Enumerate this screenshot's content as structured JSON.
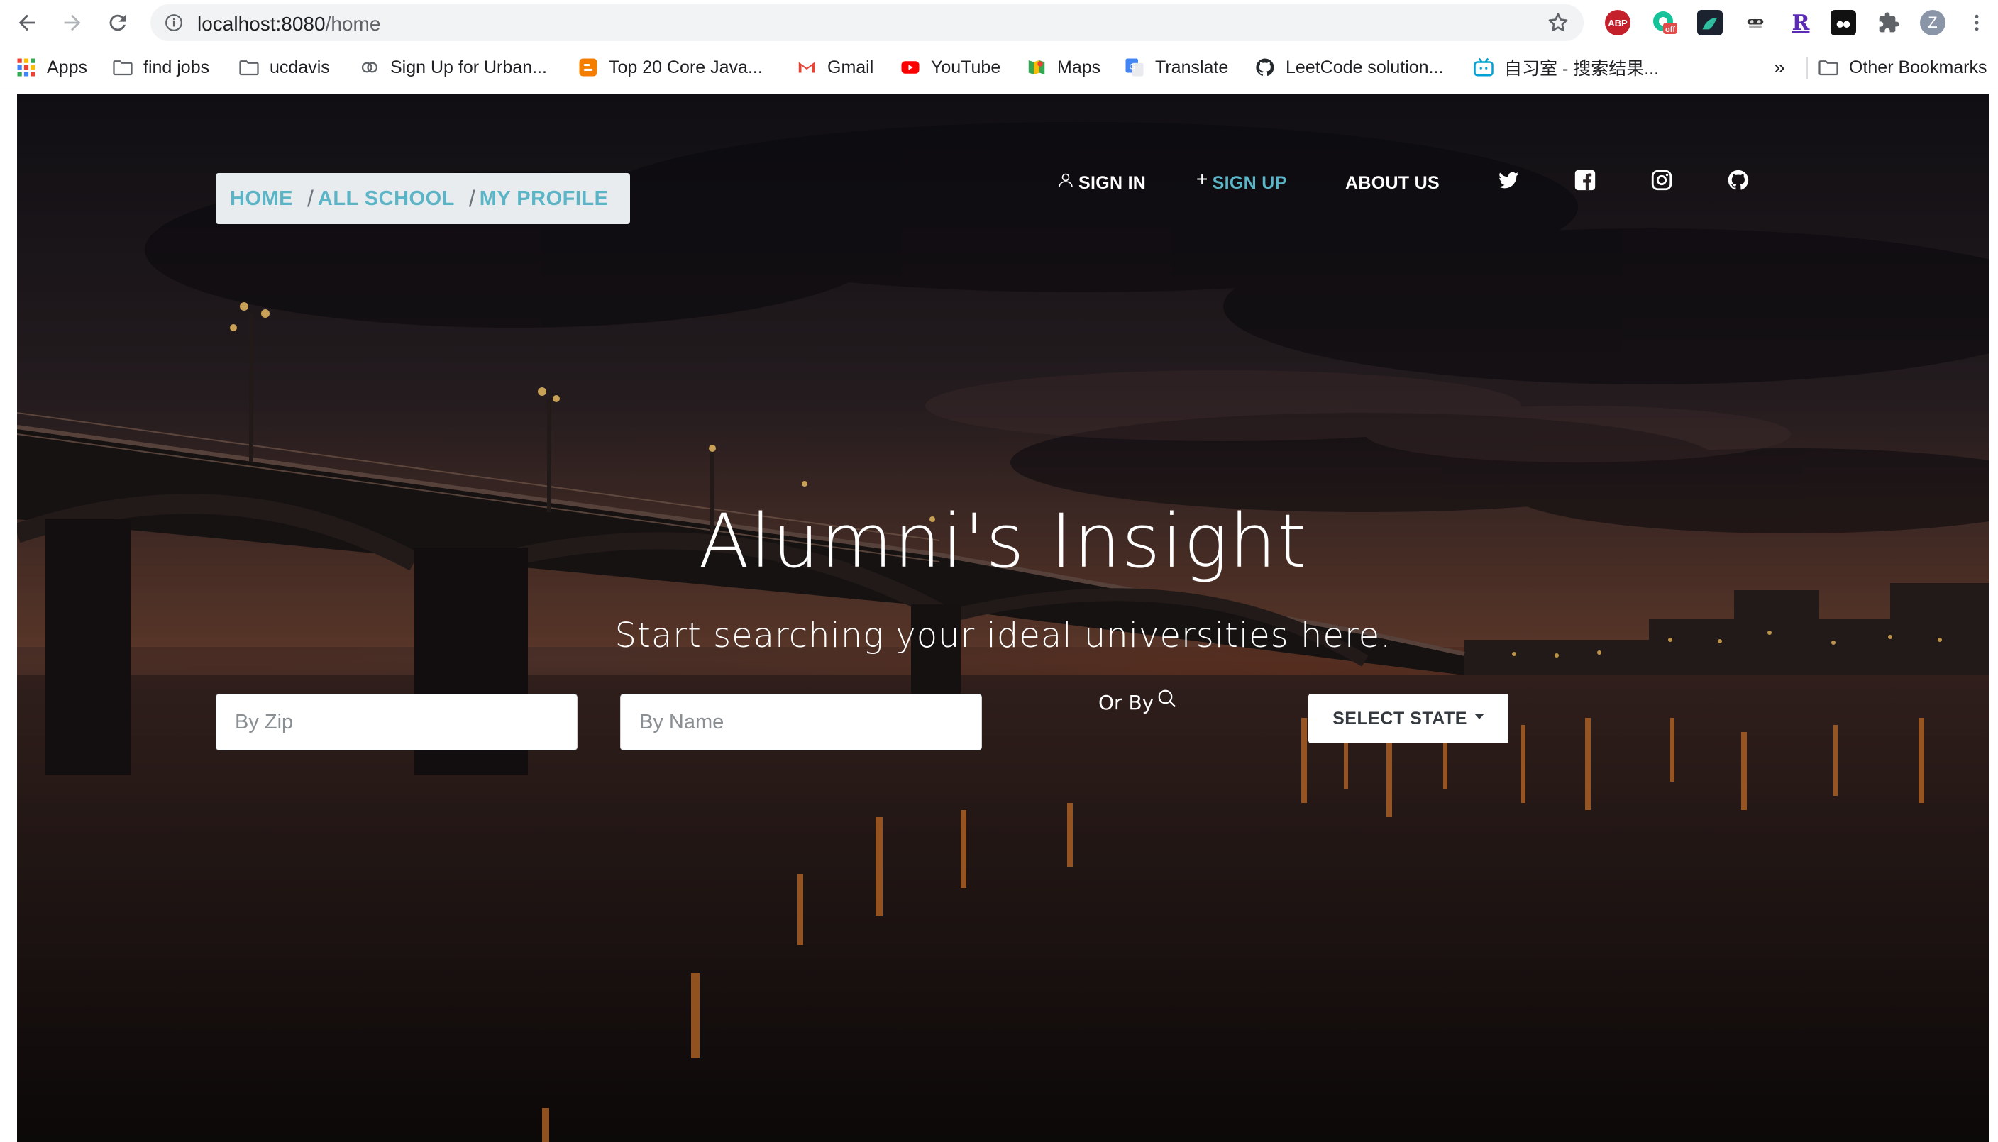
{
  "browser": {
    "url_host": "localhost:8080",
    "url_path": "/home"
  },
  "bookmarks": [
    {
      "label": "Apps",
      "icon": "apps-grid-icon"
    },
    {
      "label": "find jobs",
      "icon": "folder-icon"
    },
    {
      "label": "ucdavis",
      "icon": "folder-icon"
    },
    {
      "label": "Sign Up for Urban...",
      "icon": "link-icon"
    },
    {
      "label": "Top 20 Core Java...",
      "icon": "blogger-icon"
    },
    {
      "label": "Gmail",
      "icon": "gmail-icon"
    },
    {
      "label": "YouTube",
      "icon": "youtube-icon"
    },
    {
      "label": "Maps",
      "icon": "maps-icon"
    },
    {
      "label": "Translate",
      "icon": "translate-icon"
    },
    {
      "label": "LeetCode solution...",
      "icon": "github-icon"
    },
    {
      "label": "自习室 - 搜索结果...",
      "icon": "bilibili-icon"
    }
  ],
  "bookmarks_overflow": "»",
  "other_bookmarks": "Other Bookmarks",
  "extensions": {
    "abp": "ABP",
    "off_badge": "off",
    "r_ext": "R",
    "profile_initial": "Z"
  },
  "breadcrumb": {
    "items": [
      "HOME",
      "ALL SCHOOL",
      "MY PROFILE"
    ],
    "separator": "/"
  },
  "nav": {
    "sign_in": "SIGN IN",
    "sign_up": "SIGN UP",
    "about_us": "ABOUT US"
  },
  "hero": {
    "title": "Alumni's Insight",
    "subtitle": "Start searching your ideal universities here."
  },
  "search": {
    "zip_placeholder": "By Zip",
    "name_placeholder": "By Name",
    "or_by_label": "Or By",
    "select_state_label": "SELECT STATE"
  },
  "colors": {
    "accent": "#5bb5c6",
    "breadcrumb_bg": "#e9ecef"
  }
}
